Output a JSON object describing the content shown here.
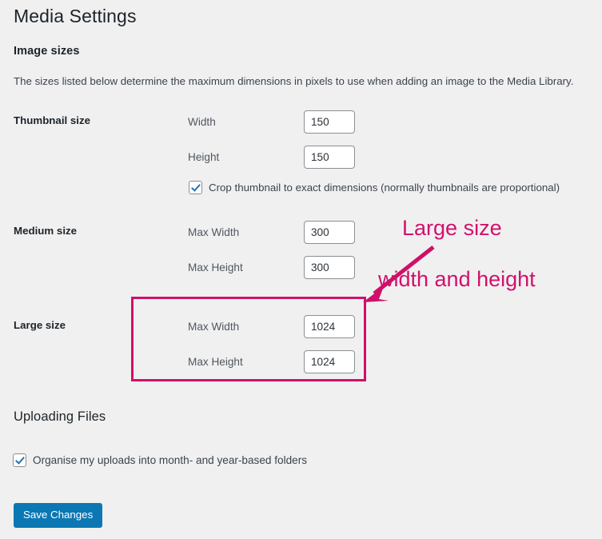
{
  "page": {
    "title": "Media Settings",
    "background_color": "#f0f0f1"
  },
  "image_sizes": {
    "heading": "Image sizes",
    "description": "The sizes listed below determine the maximum dimensions in pixels to use when adding an image to the Media Library.",
    "thumbnail": {
      "label": "Thumbnail size",
      "width_label": "Width",
      "width_value": "150",
      "height_label": "Height",
      "height_value": "150",
      "crop_label": "Crop thumbnail to exact dimensions (normally thumbnails are proportional)",
      "crop_checked": true
    },
    "medium": {
      "label": "Medium size",
      "max_width_label": "Max Width",
      "max_width_value": "300",
      "max_height_label": "Max Height",
      "max_height_value": "300"
    },
    "large": {
      "label": "Large size",
      "max_width_label": "Max Width",
      "max_width_value": "1024",
      "max_height_label": "Max Height",
      "max_height_value": "1024"
    }
  },
  "uploading_files": {
    "heading": "Uploading Files",
    "organise_label": "Organise my uploads into month- and year-based folders",
    "organise_checked": true
  },
  "actions": {
    "save_label": "Save Changes",
    "save_color": "#0b78b4"
  },
  "annotation": {
    "line1": "Large size",
    "line2": "width and height",
    "color": "#d2116b",
    "box_color": "#cf1069"
  }
}
